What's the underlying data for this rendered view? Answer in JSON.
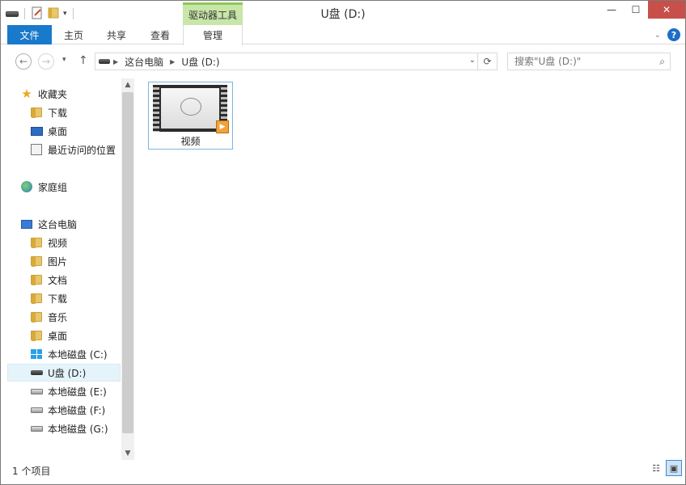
{
  "window": {
    "title": "U盘 (D:)",
    "context_tab": "驱动器工具"
  },
  "ribbon": {
    "tabs": [
      "文件",
      "主页",
      "共享",
      "查看",
      "管理"
    ]
  },
  "nav": {
    "breadcrumb": [
      "这台电脑",
      "U盘 (D:)"
    ],
    "search_placeholder": "搜索\"U盘 (D:)\""
  },
  "sidebar": {
    "favorites": {
      "label": "收藏夹",
      "items": [
        "下载",
        "桌面",
        "最近访问的位置"
      ]
    },
    "homegroup": {
      "label": "家庭组"
    },
    "this_pc": {
      "label": "这台电脑",
      "items": [
        "视频",
        "图片",
        "文档",
        "下载",
        "音乐",
        "桌面",
        "本地磁盘 (C:)",
        "U盘 (D:)",
        "本地磁盘 (E:)",
        "本地磁盘 (F:)",
        "本地磁盘 (G:)"
      ]
    }
  },
  "content": {
    "files": [
      {
        "name": "视频"
      }
    ]
  },
  "status": {
    "item_count": "1 个项目"
  }
}
